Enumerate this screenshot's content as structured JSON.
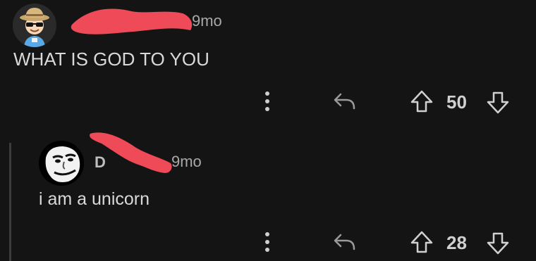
{
  "comments": [
    {
      "username": "",
      "age": "9mo",
      "body": "WHAT IS GOD TO YOU",
      "score": "50",
      "icons": {
        "more": "more-vertical-icon",
        "reply": "reply-icon",
        "upvote": "upvote-arrow-icon",
        "downvote": "downvote-arrow-icon"
      }
    },
    {
      "username": "D",
      "age": "9mo",
      "body": "i am a unicorn",
      "score": "28",
      "icons": {
        "more": "more-vertical-icon",
        "reply": "reply-icon",
        "upvote": "upvote-arrow-icon",
        "downvote": "downvote-arrow-icon"
      }
    }
  ],
  "colors": {
    "background": "#141414",
    "text": "#d9d9d9",
    "muted": "#a8a8a8",
    "redaction": "#ef4a57"
  }
}
